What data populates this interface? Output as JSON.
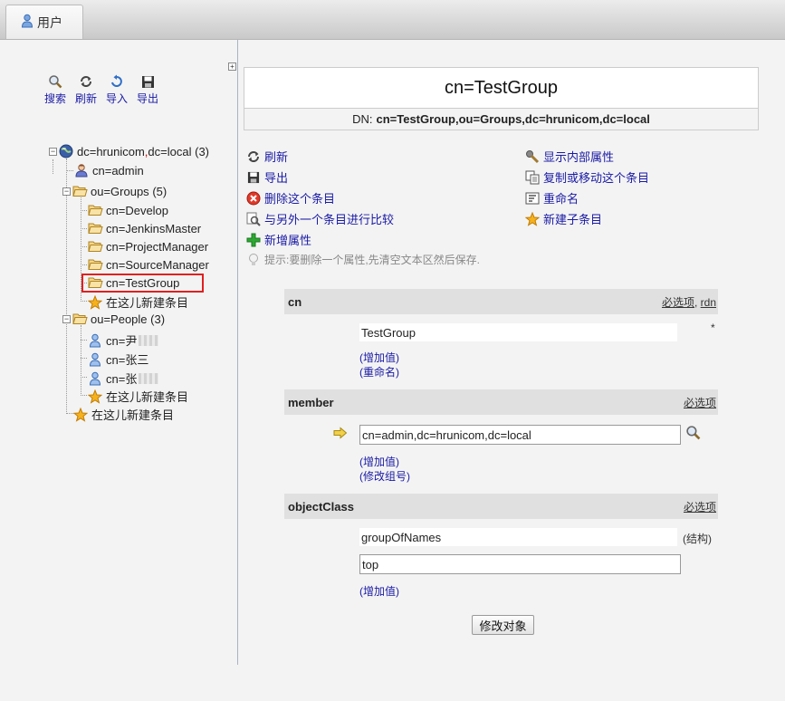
{
  "tab": {
    "label": "用户"
  },
  "toolbar": {
    "search": "搜索",
    "refresh": "刷新",
    "import": "导入",
    "export": "导出"
  },
  "tree": {
    "root": {
      "label_a": "dc=hrunicom",
      "comma": ",",
      "label_b": "dc=local",
      "count": "(3)"
    },
    "admin": "cn=admin",
    "groups": {
      "label": "ou=Groups",
      "count": "(5)"
    },
    "group_items": [
      "cn=Develop",
      "cn=JenkinsMaster",
      "cn=ProjectManager",
      "cn=SourceManager",
      "cn=TestGroup"
    ],
    "new_here": "在这儿新建条目",
    "people": {
      "label": "ou=People",
      "count": "(3)"
    },
    "people_items": [
      "cn=尹",
      "cn=张三",
      "cn=张"
    ]
  },
  "entry": {
    "title": "cn=TestGroup",
    "dn_label": "DN:",
    "dn_value": "cn=TestGroup,ou=Groups,dc=hrunicom,dc=local"
  },
  "actions": {
    "refresh": "刷新",
    "export": "导出",
    "delete": "删除这个条目",
    "compare": "与另外一个条目进行比较",
    "add_attr": "新增属性",
    "hint": "提示:要删除一个属性,先清空文本区然后保存.",
    "show_internal": "显示内部属性",
    "copy_move": "复制或移动这个条目",
    "rename": "重命名",
    "new_child": "新建子条目"
  },
  "attrs": {
    "cn": {
      "name": "cn",
      "link_required": "必选项",
      "sep": ", ",
      "link_rdn": "rdn",
      "value": "TestGroup",
      "star": "*",
      "add_value": "(增加值)",
      "rename": "(重命名)"
    },
    "member": {
      "name": "member",
      "link_required": "必选项",
      "value": "cn=admin,dc=hrunicom,dc=local",
      "add_value": "(增加值)",
      "modify_group": "(修改组号)"
    },
    "objectClass": {
      "name": "objectClass",
      "link_required": "必选项",
      "value1": "groupOfNames",
      "structural": "(结构)",
      "value2": "top",
      "add_value": "(增加值)"
    }
  },
  "submit": "修改对象",
  "colors": {
    "link": "#1a1aa6",
    "selection_border": "#e02020",
    "attr_header_bg": "#e0e0e0",
    "folder": "#e8b339",
    "star": "#f0a818"
  }
}
